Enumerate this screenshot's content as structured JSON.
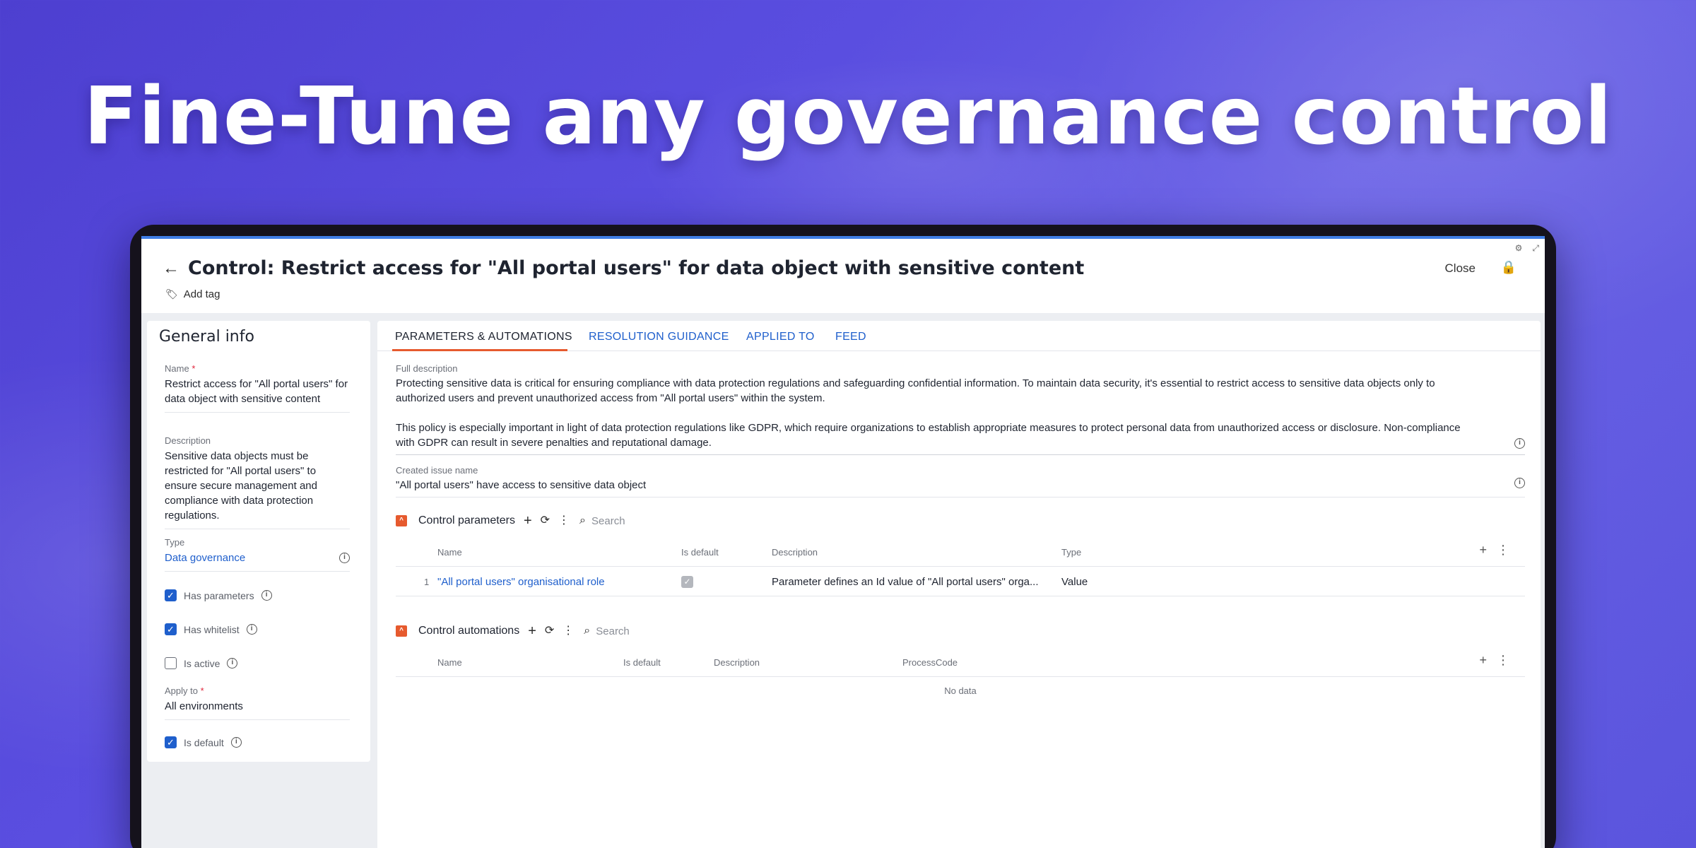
{
  "headline": "Fine-Tune any governance control",
  "header": {
    "title": "Control: Restrict access for \"All portal users\" for data object with sensitive content",
    "add_tag": "Add tag",
    "close": "Close"
  },
  "general_info": {
    "heading": "General info",
    "name_label": "Name",
    "name_value": "Restrict access for \"All portal users\" for data object with sensitive content",
    "description_label": "Description",
    "description_value": "Sensitive data objects must be restricted for \"All portal users\" to ensure secure management and compliance with data protection regulations.",
    "type_label": "Type",
    "type_value": "Data governance",
    "has_parameters": "Has parameters",
    "has_whitelist": "Has whitelist",
    "is_active": "Is active",
    "apply_to_label": "Apply to",
    "apply_to_value": "All environments",
    "is_default": "Is default",
    "required_mark": "*"
  },
  "checkboxes": {
    "has_parameters": true,
    "has_whitelist": true,
    "is_active": false,
    "is_default": true
  },
  "tabs": [
    {
      "label": "PARAMETERS & AUTOMATIONS",
      "active": true
    },
    {
      "label": "RESOLUTION GUIDANCE",
      "active": false
    },
    {
      "label": "APPLIED TO",
      "active": false
    },
    {
      "label": "FEED",
      "active": false
    }
  ],
  "full_description": {
    "label": "Full description",
    "paragraph1": "Protecting sensitive data is critical for ensuring compliance with data protection regulations and safeguarding confidential information. To maintain data security, it's essential to restrict access to sensitive data objects only to authorized users and prevent unauthorized access from \"All portal users\" within the system.",
    "paragraph2": "This policy is especially important in light of data protection regulations like GDPR, which require organizations to establish appropriate measures to protect personal data from unauthorized access or disclosure. Non-compliance with GDPR can result in severe penalties and reputational damage."
  },
  "created_issue": {
    "label": "Created issue name",
    "value": "\"All portal users\" have access to sensitive data object"
  },
  "control_parameters": {
    "title": "Control parameters",
    "search_placeholder": "Search",
    "columns": [
      "Name",
      "Is default",
      "Description",
      "Type"
    ],
    "rows": [
      {
        "index": "1",
        "name": "\"All portal users\" organisational role",
        "is_default": true,
        "description": "Parameter defines an Id value of \"All portal users\" orga...",
        "type": "Value"
      }
    ]
  },
  "control_automations": {
    "title": "Control automations",
    "search_placeholder": "Search",
    "columns": [
      "Name",
      "Is default",
      "Description",
      "ProcessCode"
    ],
    "empty_text": "No data"
  }
}
